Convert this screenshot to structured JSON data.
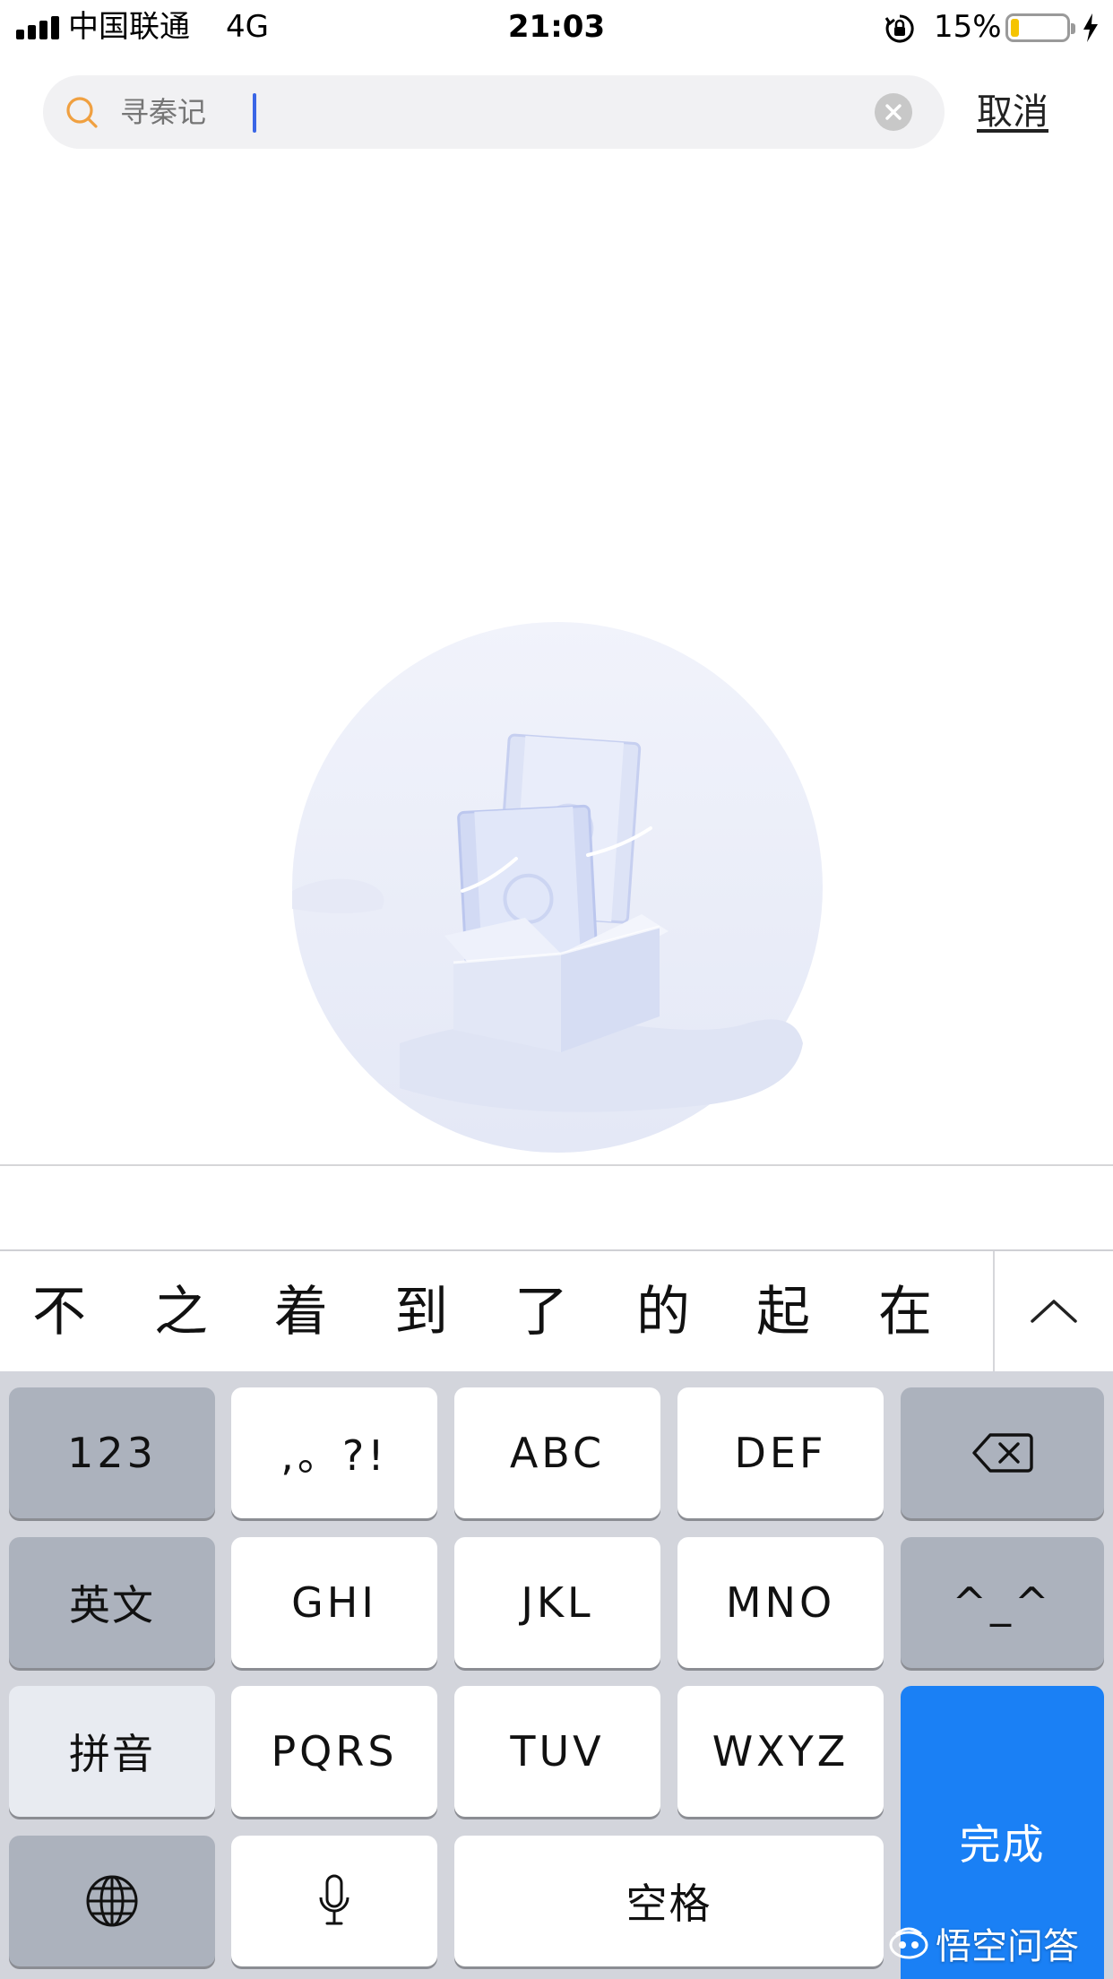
{
  "status_bar": {
    "carrier": "中国联通",
    "network": "4G",
    "time": "21:03",
    "battery_percent": "15%",
    "battery_level": 0.15,
    "icons": [
      "signal-icon",
      "orientation-lock-icon",
      "battery-icon",
      "charging-bolt-icon"
    ]
  },
  "search": {
    "placeholder": "寻秦记",
    "value": "",
    "cancel_label": "取消",
    "search_icon_color": "#f0a040"
  },
  "empty_state": {
    "illustration": "video-box-icon"
  },
  "candidates": {
    "items": [
      "不",
      "之",
      "着",
      "到",
      "了",
      "的",
      "起",
      "在"
    ],
    "expand_icon": "chevron-up-icon"
  },
  "keyboard": {
    "row1": [
      "123",
      ",。?!",
      "ABC",
      "DEF"
    ],
    "row1_delete_icon": "backspace-icon",
    "row2": [
      "英文",
      "GHI",
      "JKL",
      "MNO",
      "^_^"
    ],
    "row3": [
      "拼音",
      "PQRS",
      "TUV",
      "WXYZ"
    ],
    "done_label": "完成",
    "row4_globe_icon": "globe-icon",
    "row4_mic_icon": "microphone-icon",
    "space_label": "空格",
    "accent_color": "#1a80f5"
  },
  "watermark": {
    "text": "悟空问答"
  }
}
